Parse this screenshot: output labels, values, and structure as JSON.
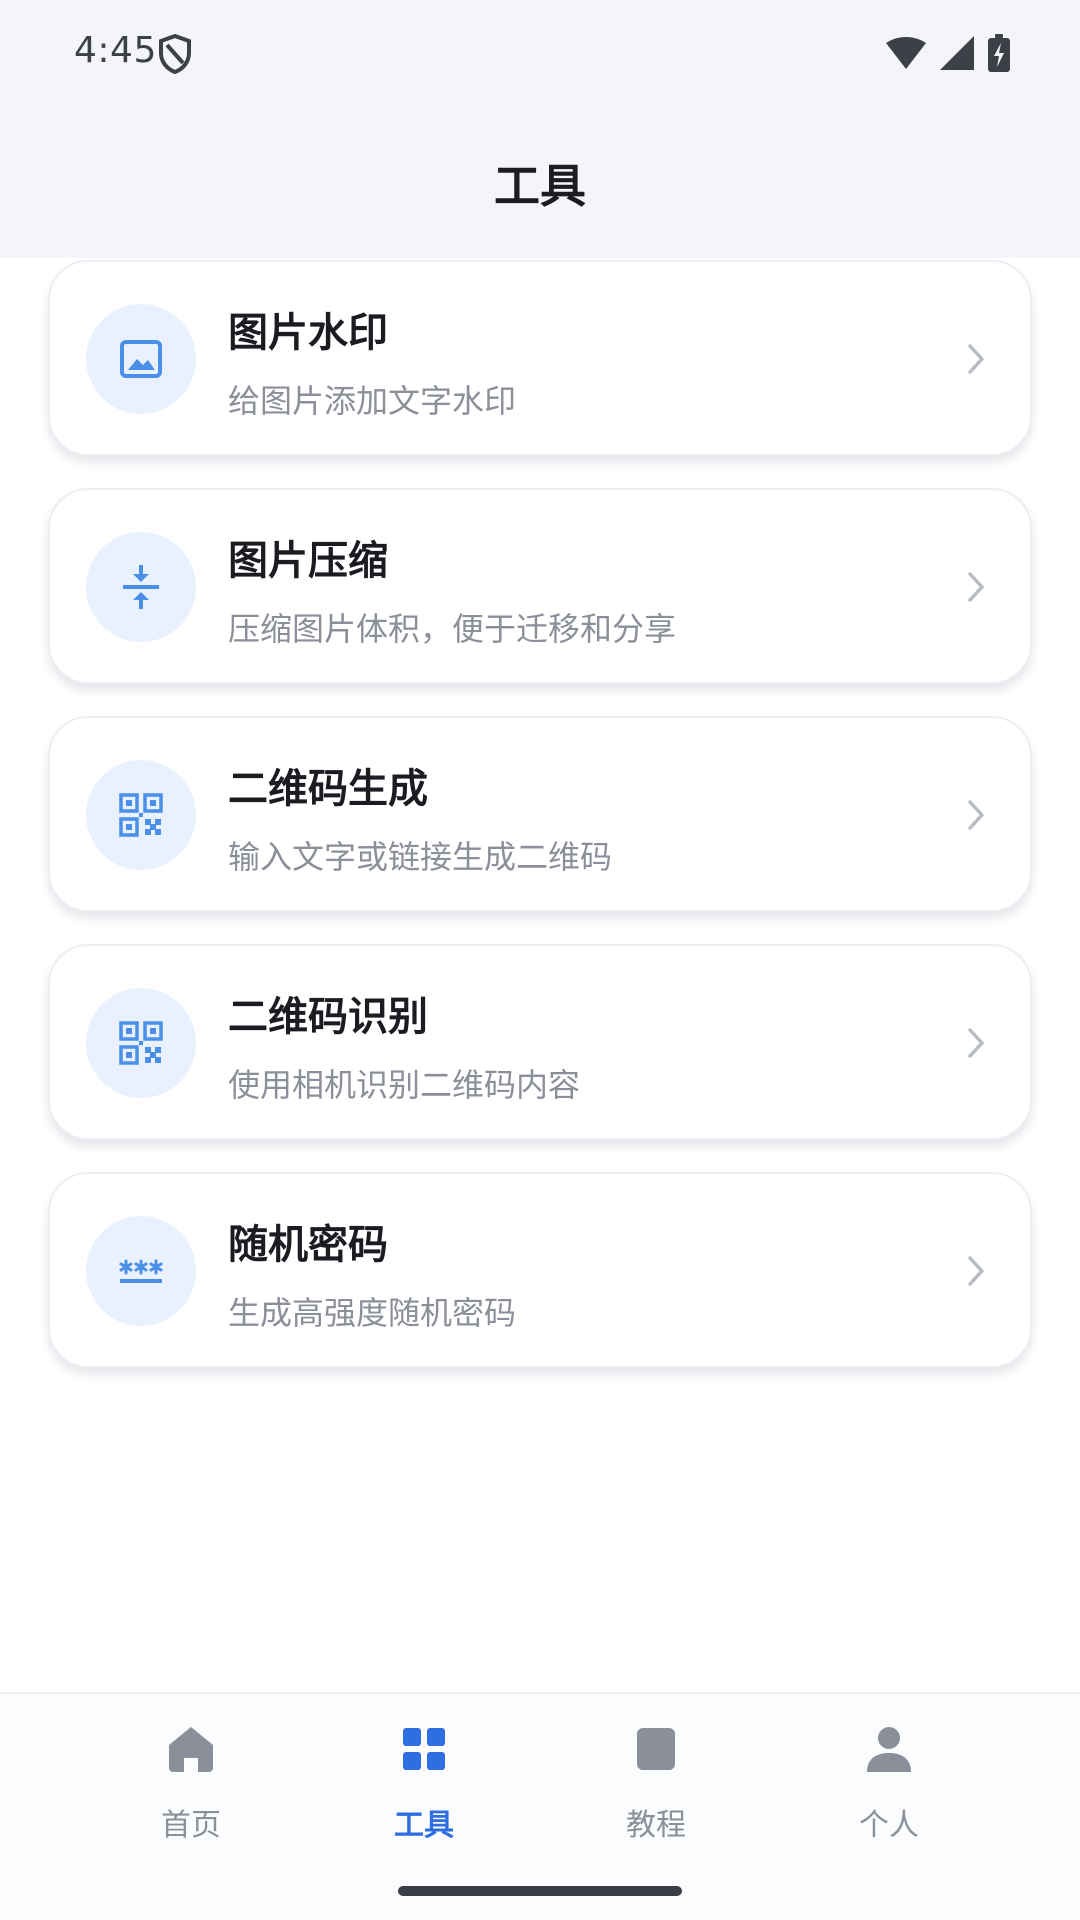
{
  "status_bar": {
    "time": "4:45",
    "icons": [
      "shield-icon",
      "wifi-icon",
      "cell-signal-icon",
      "battery-charging-icon"
    ]
  },
  "header": {
    "title": "工具"
  },
  "tools": [
    {
      "name": "图片水印",
      "desc": "给图片添加文字水印",
      "icon": "image-icon"
    },
    {
      "name": "图片压缩",
      "desc": "压缩图片体积，便于迁移和分享",
      "icon": "compress-icon"
    },
    {
      "name": "二维码生成",
      "desc": "输入文字或链接生成二维码",
      "icon": "qr-code-icon"
    },
    {
      "name": "二维码识别",
      "desc": "使用相机识别二维码内容",
      "icon": "qr-code-icon"
    },
    {
      "name": "随机密码",
      "desc": "生成高强度随机密码",
      "icon": "password-icon"
    }
  ],
  "bottom_nav": {
    "items": [
      {
        "label": "首页",
        "icon": "home-icon",
        "active": false
      },
      {
        "label": "工具",
        "icon": "grid-icon",
        "active": true
      },
      {
        "label": "教程",
        "icon": "book-icon",
        "active": false
      },
      {
        "label": "个人",
        "icon": "person-icon",
        "active": false
      }
    ]
  },
  "colors": {
    "accent": "#2f6ee0",
    "icon_blue": "#4a8fe8",
    "icon_bg": "#e8f1fd",
    "header_bg": "#f4f5fa",
    "inactive": "#8a8f99"
  }
}
